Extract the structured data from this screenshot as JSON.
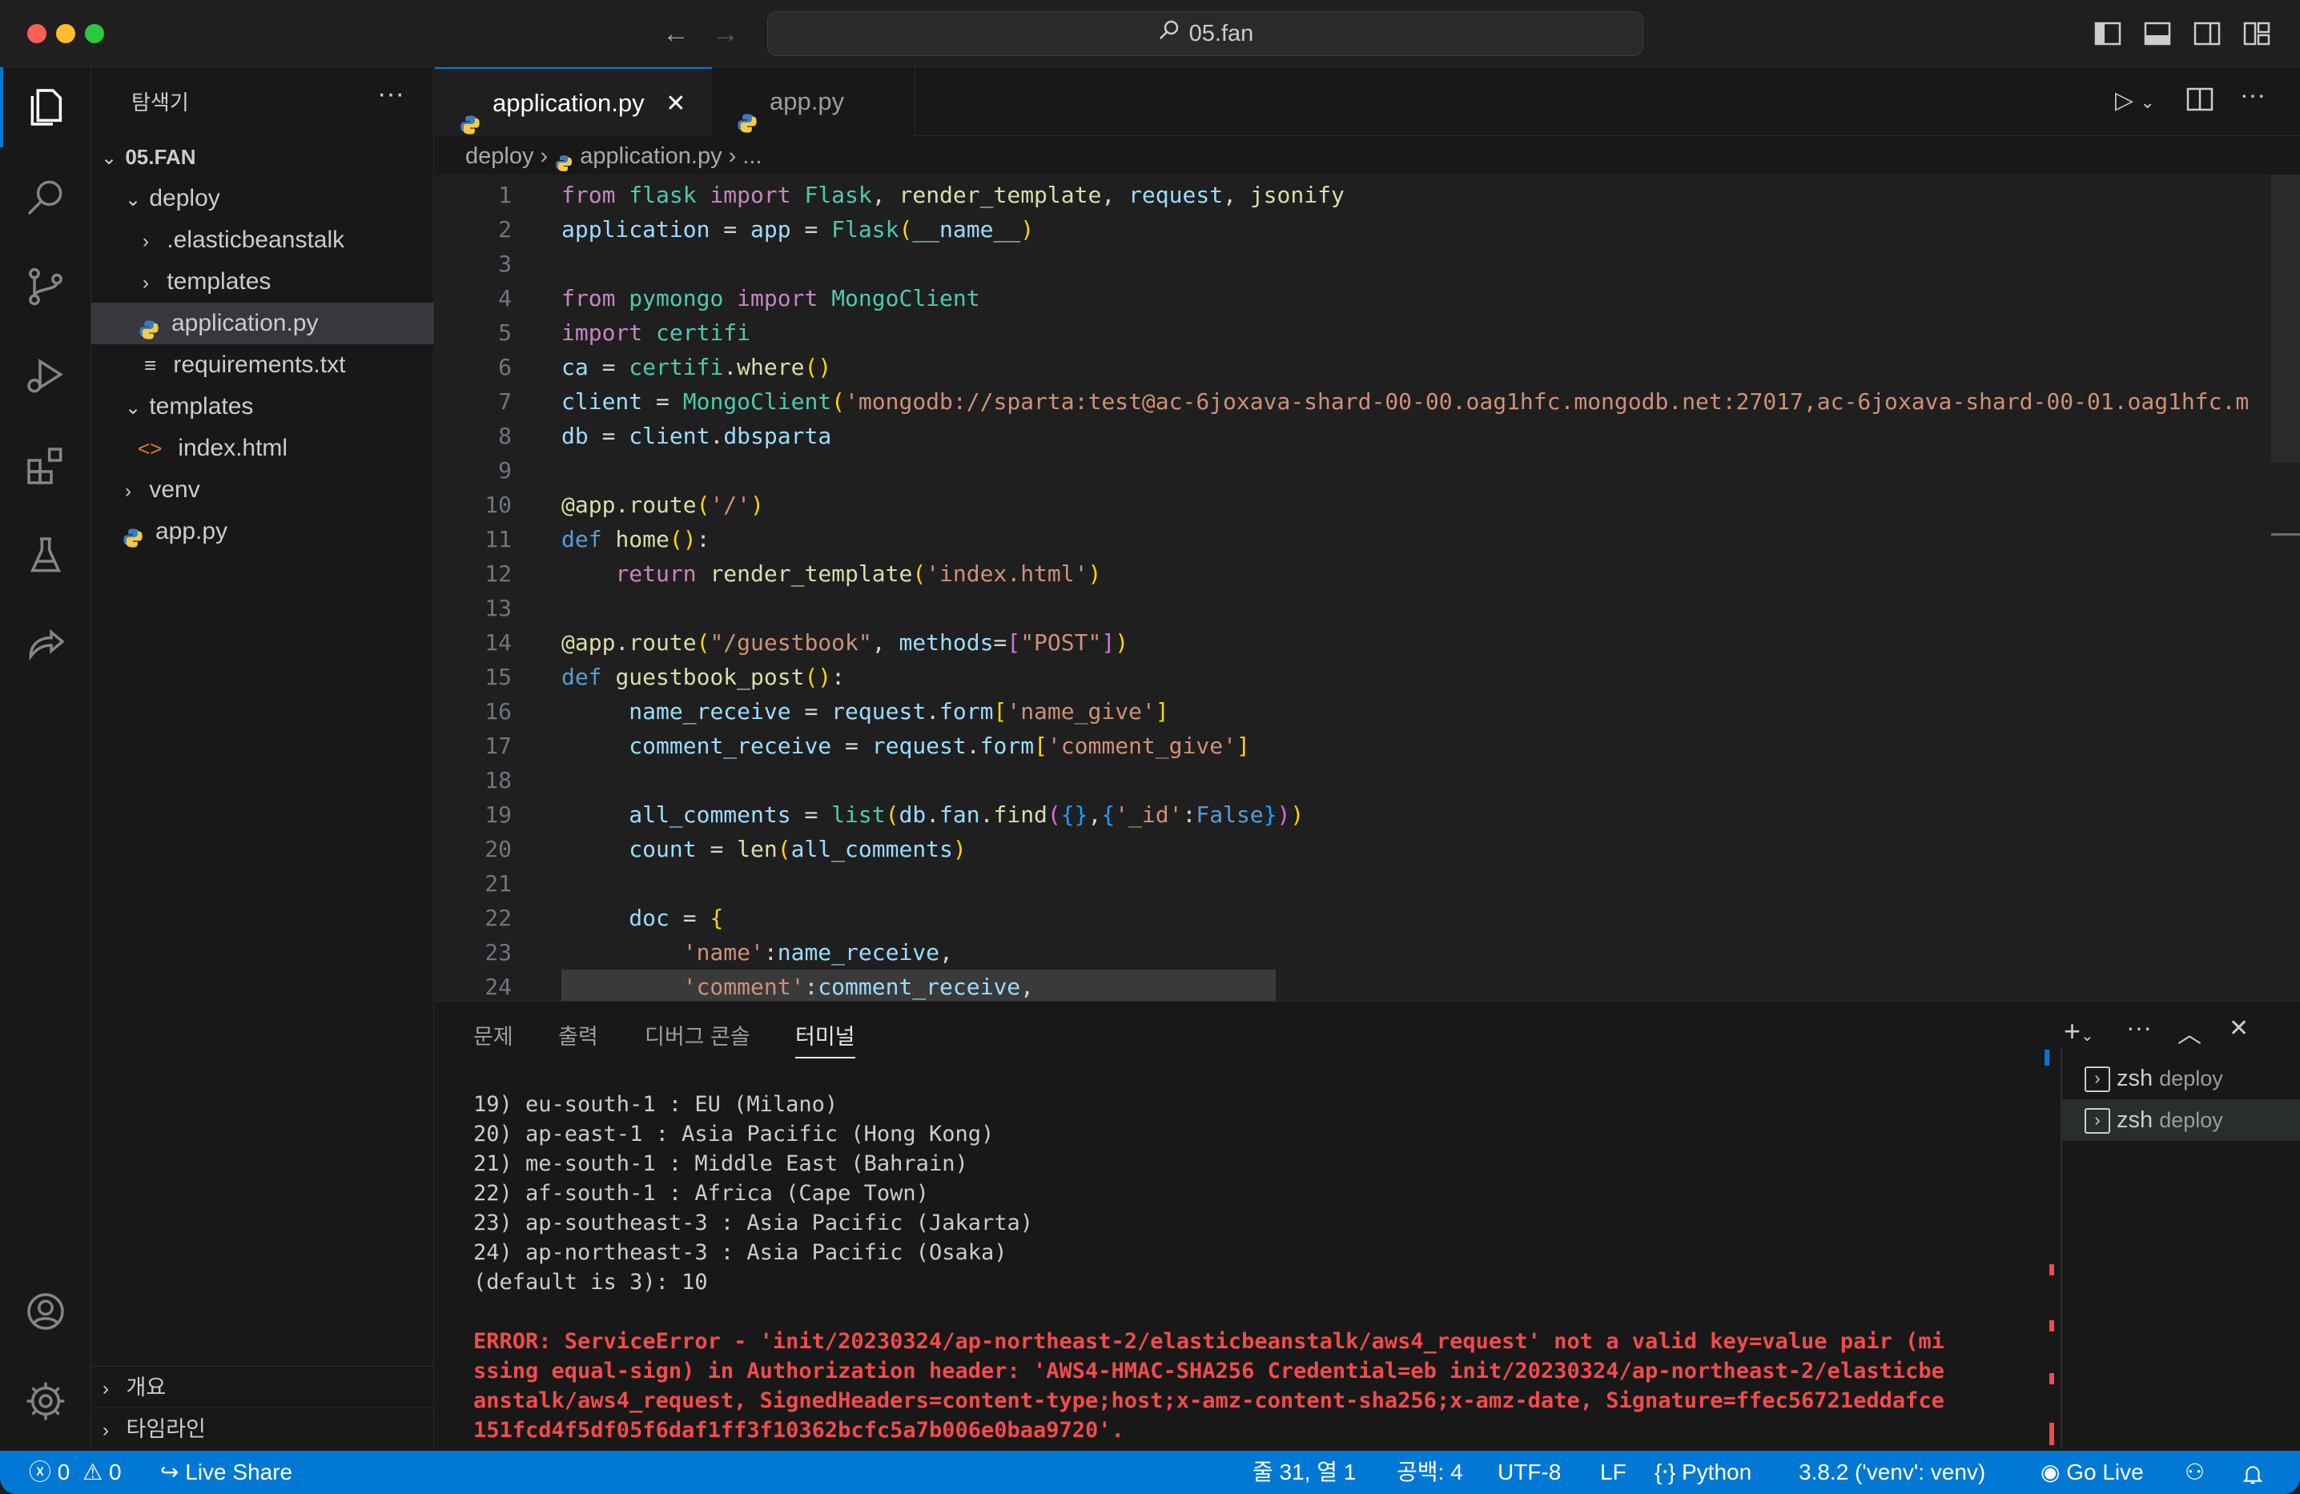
{
  "window": {
    "title": "05.fan"
  },
  "explorer": {
    "title": "탐색기",
    "more": "···",
    "root": "05.FAN",
    "items": [
      {
        "label": "deploy",
        "type": "folder-open"
      },
      {
        "label": ".elasticbeanstalk",
        "type": "folder"
      },
      {
        "label": "templates",
        "type": "folder"
      },
      {
        "label": "application.py",
        "type": "python"
      },
      {
        "label": "requirements.txt",
        "type": "text"
      },
      {
        "label": "templates",
        "type": "folder-open"
      },
      {
        "label": "index.html",
        "type": "html"
      },
      {
        "label": "venv",
        "type": "folder"
      },
      {
        "label": "app.py",
        "type": "python"
      }
    ],
    "outline": "개요",
    "timeline": "타임라인"
  },
  "tabs": [
    {
      "label": "application.py"
    },
    {
      "label": "app.py"
    }
  ],
  "breadcrumb": {
    "folder": "deploy",
    "file": "application.py",
    "rest": "..."
  },
  "panel": {
    "tabs": [
      "문제",
      "출력",
      "디버그 콘솔",
      "터미널"
    ],
    "terminal_lines": [
      "19) eu-south-1 : EU (Milano)",
      "20) ap-east-1 : Asia Pacific (Hong Kong)",
      "21) me-south-1 : Middle East (Bahrain)",
      "22) af-south-1 : Africa (Cape Town)",
      "23) ap-southeast-3 : Asia Pacific (Jakarta)",
      "24) ap-northeast-3 : Asia Pacific (Osaka)",
      "(default is 3): 10"
    ],
    "error_lines": [
      "ERROR: ServiceError - 'init/20230324/ap-northeast-2/elasticbeanstalk/aws4_request' not a valid key=value pair (mi",
      "ssing equal-sign) in Authorization header: 'AWS4-HMAC-SHA256 Credential=eb init/20230324/ap-northeast-2/elasticbe",
      "anstalk/aws4_request, SignedHeaders=content-type;host;x-amz-content-sha256;x-amz-date, Signature=ffec56721eddafce",
      "151fcd4f5df05f6daf1ff3f10362bcfc5a7b006e0baa9720'."
    ],
    "terminals": [
      {
        "shell": "zsh",
        "cwd": "deploy"
      },
      {
        "shell": "zsh",
        "cwd": "deploy"
      }
    ]
  },
  "status": {
    "errors": "0",
    "warnings": "0",
    "live_share": "Live Share",
    "position": "줄 31, 열 1",
    "spaces": "공백: 4",
    "encoding": "UTF-8",
    "eol": "LF",
    "language": "Python",
    "interpreter": "3.8.2 ('venv': venv)",
    "go_live": "Go Live"
  },
  "colors": {
    "accent": "#0078d4",
    "error": "#f14c4c"
  }
}
